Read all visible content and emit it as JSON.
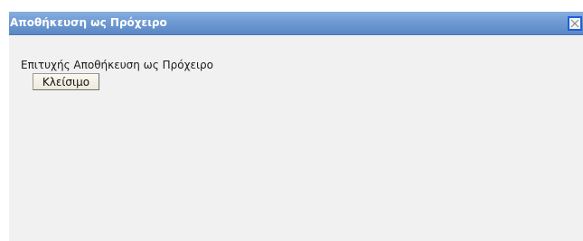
{
  "dialog": {
    "title": "Αποθήκευση ως Πρόχειρο",
    "close_icon": "close-icon",
    "message": "Επιτυχής Αποθήκευση ως Πρόχειρο",
    "close_button_label": "Κλείσιμο"
  },
  "colors": {
    "titlebar": "#6f9bd3",
    "close_border": "#1f5fd8",
    "background": "#f1f1f1"
  }
}
